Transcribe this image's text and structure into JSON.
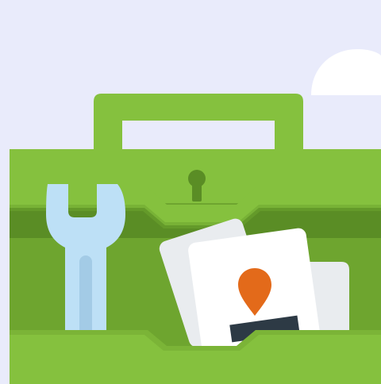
{
  "illustration": {
    "subject": "toolbox",
    "icons": [
      "wrench-icon",
      "map-pin-icon",
      "keyhole-icon",
      "cloud-icon"
    ]
  },
  "colors": {
    "background": "#e9ebfb",
    "toolbox_light": "#85c13e",
    "toolbox_mid": "#6ea52f",
    "toolbox_dark": "#5a8d25",
    "wrench": "#bde0f6",
    "wrench_shadow": "#a3cbe6",
    "card": "#ffffff",
    "card_shadow": "#e9ecef",
    "pin": "#e36a1a",
    "card_bar": "#2d3a45",
    "cloud": "#ffffff"
  }
}
